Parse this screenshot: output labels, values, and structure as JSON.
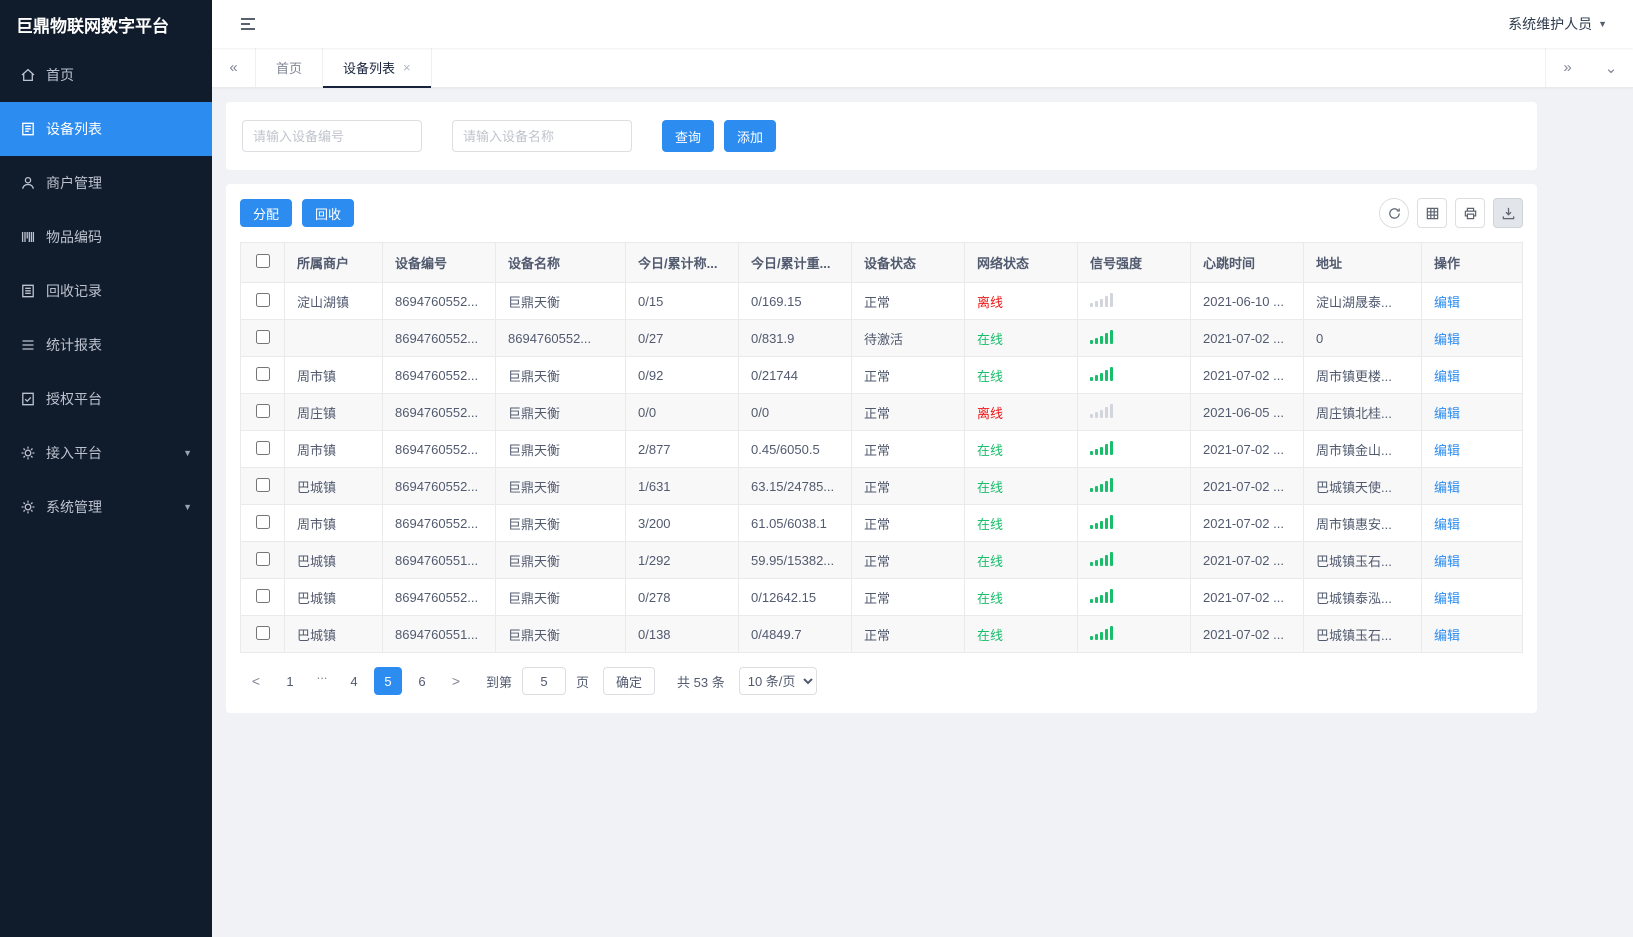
{
  "app": {
    "title": "巨鼎物联网数字平台",
    "user_menu": "系统维护人员"
  },
  "sidebar": {
    "items": [
      {
        "label": "首页",
        "icon": "home-icon",
        "active": false,
        "expandable": false
      },
      {
        "label": "设备列表",
        "icon": "device-list-icon",
        "active": true,
        "expandable": false
      },
      {
        "label": "商户管理",
        "icon": "merchant-icon",
        "active": false,
        "expandable": false
      },
      {
        "label": "物品编码",
        "icon": "item-code-icon",
        "active": false,
        "expandable": false
      },
      {
        "label": "回收记录",
        "icon": "recycle-record-icon",
        "active": false,
        "expandable": false
      },
      {
        "label": "统计报表",
        "icon": "report-icon",
        "active": false,
        "expandable": false
      },
      {
        "label": "授权平台",
        "icon": "auth-platform-icon",
        "active": false,
        "expandable": false
      },
      {
        "label": "接入平台",
        "icon": "access-platform-icon",
        "active": false,
        "expandable": true
      },
      {
        "label": "系统管理",
        "icon": "system-manage-icon",
        "active": false,
        "expandable": true
      }
    ]
  },
  "tabbar": {
    "tabs": [
      {
        "label": "首页",
        "active": false,
        "closable": false
      },
      {
        "label": "设备列表",
        "active": true,
        "closable": true
      }
    ]
  },
  "search": {
    "device_no_placeholder": "请输入设备编号",
    "device_name_placeholder": "请输入设备名称",
    "query_label": "查询",
    "add_label": "添加"
  },
  "toolbar": {
    "assign_label": "分配",
    "recycle_label": "回收"
  },
  "table": {
    "columns": [
      "所属商户",
      "设备编号",
      "设备名称",
      "今日/累计称...",
      "今日/累计重...",
      "设备状态",
      "网络状态",
      "信号强度",
      "心跳时间",
      "地址",
      "操作"
    ],
    "edit_label": "编辑",
    "rows": [
      {
        "merchant": "淀山湖镇",
        "device_no": "8694760552...",
        "device_name": "巨鼎天衡",
        "today_count": "0/15",
        "today_weight": "0/169.15",
        "device_status": "正常",
        "network_status": "离线",
        "online": false,
        "heartbeat": "2021-06-10 ...",
        "address": "淀山湖晟泰..."
      },
      {
        "merchant": "",
        "device_no": "8694760552...",
        "device_name": "8694760552...",
        "today_count": "0/27",
        "today_weight": "0/831.9",
        "device_status": "待激活",
        "network_status": "在线",
        "online": true,
        "heartbeat": "2021-07-02 ...",
        "address": "0"
      },
      {
        "merchant": "周市镇",
        "device_no": "8694760552...",
        "device_name": "巨鼎天衡",
        "today_count": "0/92",
        "today_weight": "0/21744",
        "device_status": "正常",
        "network_status": "在线",
        "online": true,
        "heartbeat": "2021-07-02 ...",
        "address": "周市镇更楼..."
      },
      {
        "merchant": "周庄镇",
        "device_no": "8694760552...",
        "device_name": "巨鼎天衡",
        "today_count": "0/0",
        "today_weight": "0/0",
        "device_status": "正常",
        "network_status": "离线",
        "online": false,
        "heartbeat": "2021-06-05 ...",
        "address": "周庄镇北桂..."
      },
      {
        "merchant": "周市镇",
        "device_no": "8694760552...",
        "device_name": "巨鼎天衡",
        "today_count": "2/877",
        "today_weight": "0.45/6050.5",
        "device_status": "正常",
        "network_status": "在线",
        "online": true,
        "heartbeat": "2021-07-02 ...",
        "address": "周市镇金山..."
      },
      {
        "merchant": "巴城镇",
        "device_no": "8694760552...",
        "device_name": "巨鼎天衡",
        "today_count": "1/631",
        "today_weight": "63.15/24785...",
        "device_status": "正常",
        "network_status": "在线",
        "online": true,
        "heartbeat": "2021-07-02 ...",
        "address": "巴城镇天使..."
      },
      {
        "merchant": "周市镇",
        "device_no": "8694760552...",
        "device_name": "巨鼎天衡",
        "today_count": "3/200",
        "today_weight": "61.05/6038.1",
        "device_status": "正常",
        "network_status": "在线",
        "online": true,
        "heartbeat": "2021-07-02 ...",
        "address": "周市镇惠安..."
      },
      {
        "merchant": "巴城镇",
        "device_no": "8694760551...",
        "device_name": "巨鼎天衡",
        "today_count": "1/292",
        "today_weight": "59.95/15382...",
        "device_status": "正常",
        "network_status": "在线",
        "online": true,
        "heartbeat": "2021-07-02 ...",
        "address": "巴城镇玉石..."
      },
      {
        "merchant": "巴城镇",
        "device_no": "8694760552...",
        "device_name": "巨鼎天衡",
        "today_count": "0/278",
        "today_weight": "0/12642.15",
        "device_status": "正常",
        "network_status": "在线",
        "online": true,
        "heartbeat": "2021-07-02 ...",
        "address": "巴城镇泰泓..."
      },
      {
        "merchant": "巴城镇",
        "device_no": "8694760551...",
        "device_name": "巨鼎天衡",
        "today_count": "0/138",
        "today_weight": "0/4849.7",
        "device_status": "正常",
        "network_status": "在线",
        "online": true,
        "heartbeat": "2021-07-02 ...",
        "address": "巴城镇玉石..."
      }
    ]
  },
  "pagination": {
    "pages": [
      "1",
      "...",
      "4",
      "5",
      "6"
    ],
    "active_page": "5",
    "goto_prefix": "到第",
    "goto_value": "5",
    "goto_suffix": "页",
    "confirm_label": "确定",
    "total_text": "共 53 条",
    "page_size": "10 条/页"
  },
  "colors": {
    "primary": "#2d8cf0",
    "online": "#19be6b",
    "offline": "#f01414",
    "sidebar_bg": "#101b2c"
  }
}
